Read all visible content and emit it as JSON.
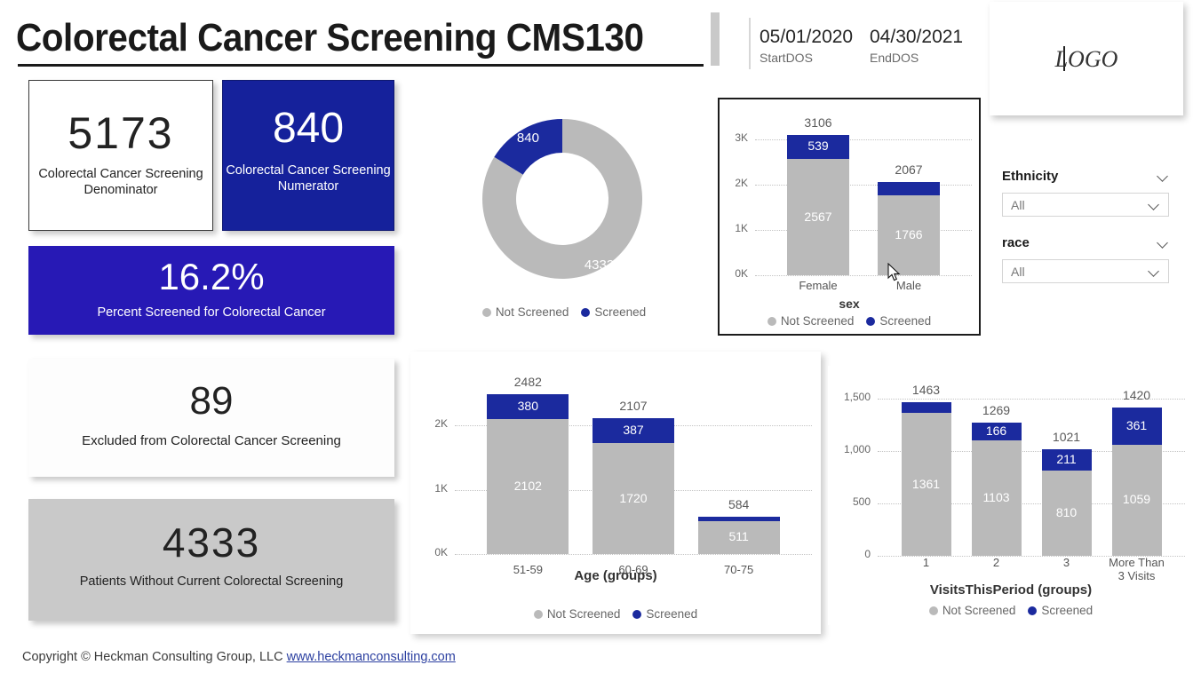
{
  "header": {
    "title": "Colorectal Cancer Screening CMS130",
    "start_date_value": "05/01/2020",
    "start_date_label": "StartDOS",
    "end_date_value": "04/30/2021",
    "end_date_label": "EndDOS"
  },
  "cards": {
    "denominator": {
      "value": "5173",
      "label": "Colorectal Cancer Screening Denominator"
    },
    "numerator": {
      "value": "840",
      "label": "Colorectal Cancer Screening Numerator"
    },
    "percent": {
      "value": "16.2%",
      "label": "Percent Screened for Colorectal Cancer"
    },
    "excluded": {
      "value": "89",
      "label": "Excluded from Colorectal Cancer Screening"
    },
    "without": {
      "value": "4333",
      "label": "Patients Without Current Colorectal Screening"
    }
  },
  "legend": {
    "not_screened": "Not Screened",
    "screened": "Screened"
  },
  "right_rail": {
    "logo_text": "LOGO",
    "slicers": [
      {
        "name": "Ethnicity",
        "value": "All"
      },
      {
        "name": "race",
        "value": "All"
      }
    ]
  },
  "footer": {
    "copyright": "Copyright © Heckman Consulting Group, LLC",
    "link_text": "www.heckmanconsulting.com"
  },
  "colors": {
    "screened_blue": "#1b2a9e",
    "not_screened_grey": "#bababa",
    "card_navy": "#15219b",
    "card_violet": "#2719b5"
  },
  "chart_data": [
    {
      "id": "donut-screening",
      "type": "pie",
      "title": "",
      "labels": [
        "Not Screened",
        "Screened"
      ],
      "values": [
        4333,
        840
      ],
      "colors": [
        "#bababa",
        "#1b2a9e"
      ],
      "legend_position": "bottom",
      "donut": true
    },
    {
      "id": "sex-stacked",
      "type": "bar",
      "stacked": true,
      "categories": [
        "Female",
        "Male"
      ],
      "series": [
        {
          "name": "Not Screened",
          "values": [
            2567,
            1766
          ],
          "color": "#bababa"
        },
        {
          "name": "Screened",
          "values": [
            539,
            301
          ],
          "color": "#1b2a9e"
        }
      ],
      "totals": [
        3106,
        2067
      ],
      "segment_labels": {
        "Not Screened": [
          "2567",
          "1766"
        ],
        "Screened": [
          "539",
          ""
        ]
      },
      "xlabel": "sex",
      "ylabel": "",
      "ylim": [
        0,
        3300
      ],
      "yticks": [
        "0K",
        "1K",
        "2K",
        "3K"
      ],
      "ytick_values": [
        0,
        1000,
        2000,
        3000
      ],
      "grid": true,
      "legend_position": "bottom"
    },
    {
      "id": "age-stacked",
      "type": "bar",
      "stacked": true,
      "categories": [
        "51-59",
        "60-69",
        "70-75"
      ],
      "series": [
        {
          "name": "Not Screened",
          "values": [
            2102,
            1720,
            511
          ],
          "color": "#bababa"
        },
        {
          "name": "Screened",
          "values": [
            380,
            387,
            73
          ],
          "color": "#1b2a9e"
        }
      ],
      "totals": [
        2482,
        2107,
        584
      ],
      "segment_labels": {
        "Not Screened": [
          "2102",
          "1720",
          "511"
        ],
        "Screened": [
          "380",
          "387",
          ""
        ]
      },
      "xlabel": "Age (groups)",
      "ylabel": "",
      "ylim": [
        0,
        2650
      ],
      "yticks": [
        "0K",
        "1K",
        "2K"
      ],
      "ytick_values": [
        0,
        1000,
        2000
      ],
      "grid": true,
      "legend_position": "bottom"
    },
    {
      "id": "visits-stacked",
      "type": "bar",
      "stacked": true,
      "categories": [
        "1",
        "2",
        "3",
        "More Than 3 Visits"
      ],
      "series": [
        {
          "name": "Not Screened",
          "values": [
            1361,
            1103,
            810,
            1059
          ],
          "color": "#bababa"
        },
        {
          "name": "Screened",
          "values": [
            102,
            166,
            211,
            361
          ],
          "color": "#1b2a9e"
        }
      ],
      "totals": [
        1463,
        1269,
        1021,
        1420
      ],
      "segment_labels": {
        "Not Screened": [
          "1361",
          "1103",
          "810",
          "1059"
        ],
        "Screened": [
          "",
          "166",
          "211",
          "361"
        ]
      },
      "xlabel": "VisitsThisPeriod (groups)",
      "ylabel": "",
      "ylim": [
        0,
        1560
      ],
      "yticks": [
        "0",
        "500",
        "1,000",
        "1,500"
      ],
      "ytick_values": [
        0,
        500,
        1000,
        1500
      ],
      "grid": true,
      "legend_position": "bottom"
    }
  ]
}
